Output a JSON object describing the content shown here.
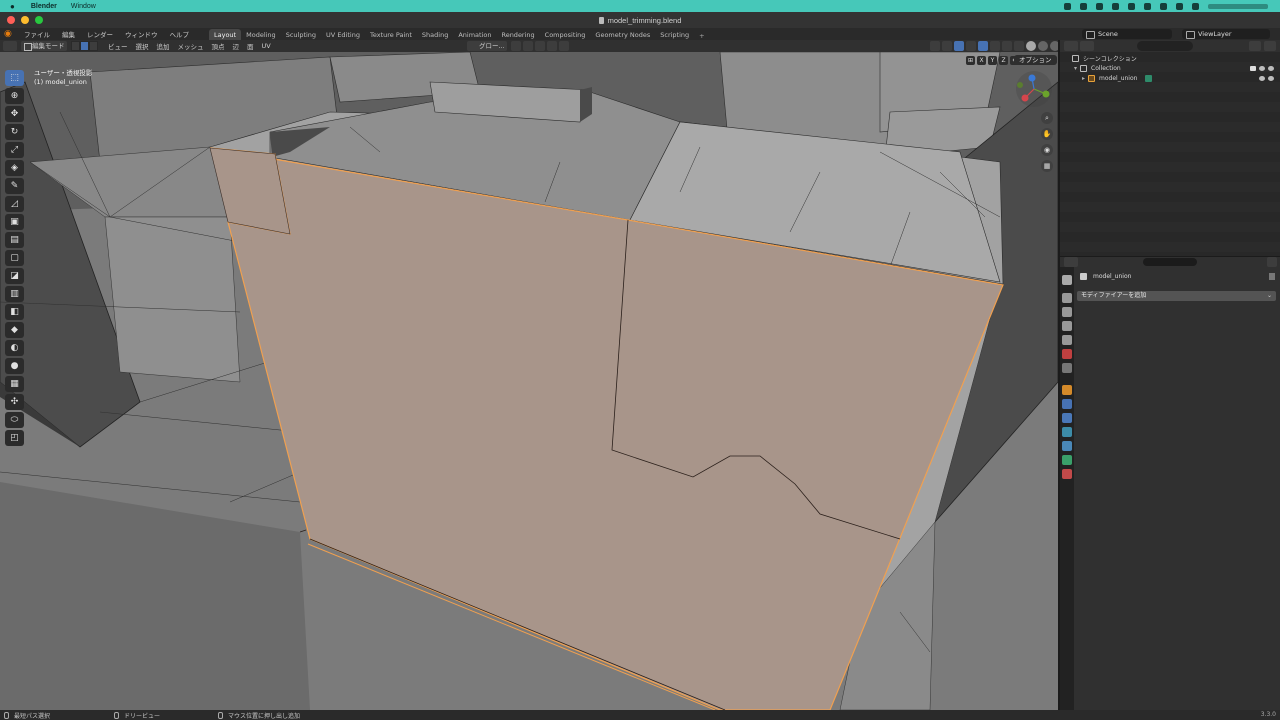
{
  "macos": {
    "apple": "",
    "app_name": "Blender",
    "menu": "Window"
  },
  "window": {
    "title": "model_trimming.blend"
  },
  "topbar": {
    "menus": [
      "ファイル",
      "編集",
      "レンダー",
      "ウィンドウ",
      "ヘルプ"
    ],
    "workspaces": [
      "Layout",
      "Modeling",
      "Sculpting",
      "UV Editing",
      "Texture Paint",
      "Shading",
      "Animation",
      "Rendering",
      "Compositing",
      "Geometry Nodes",
      "Scripting"
    ],
    "active_workspace": "Layout",
    "add_tab": "+",
    "scene": "Scene",
    "view_layer": "ViewLayer"
  },
  "viewport_header": {
    "mode": "編集モード",
    "menus": [
      "ビュー",
      "選択",
      "追加",
      "メッシュ",
      "頂点",
      "辺",
      "面",
      "UV"
    ],
    "pivot": "グロー..."
  },
  "viewport": {
    "view_name": "ユーザー・透視投影",
    "object_label": "(1) model_union",
    "options": "オプション",
    "axes": [
      "X",
      "Y",
      "Z"
    ]
  },
  "toolbar": {
    "tools": [
      "select-box",
      "cursor",
      "move",
      "rotate",
      "scale",
      "transform",
      "annotate",
      "measure",
      "add-cube",
      "extrude",
      "inset",
      "bevel",
      "loop-cut",
      "knife",
      "poly-build",
      "spin",
      "smooth",
      "edge-slide",
      "shrink-fatten",
      "shear",
      "rip"
    ]
  },
  "outliner": {
    "scene_collection": "シーンコレクション",
    "collection": "Collection",
    "object": "model_union"
  },
  "properties": {
    "object_name": "model_union",
    "add_modifier": "モディファイアーを追加"
  },
  "statusbar": {
    "left": "最短パス選択",
    "middle": "ドリービュー",
    "right": "マウス位置に押し出し追加",
    "version": "3.3.0"
  },
  "colors": {
    "selected_face": "#a8958a",
    "selected_edge": "#f0a050",
    "accent": "#4772b3"
  }
}
